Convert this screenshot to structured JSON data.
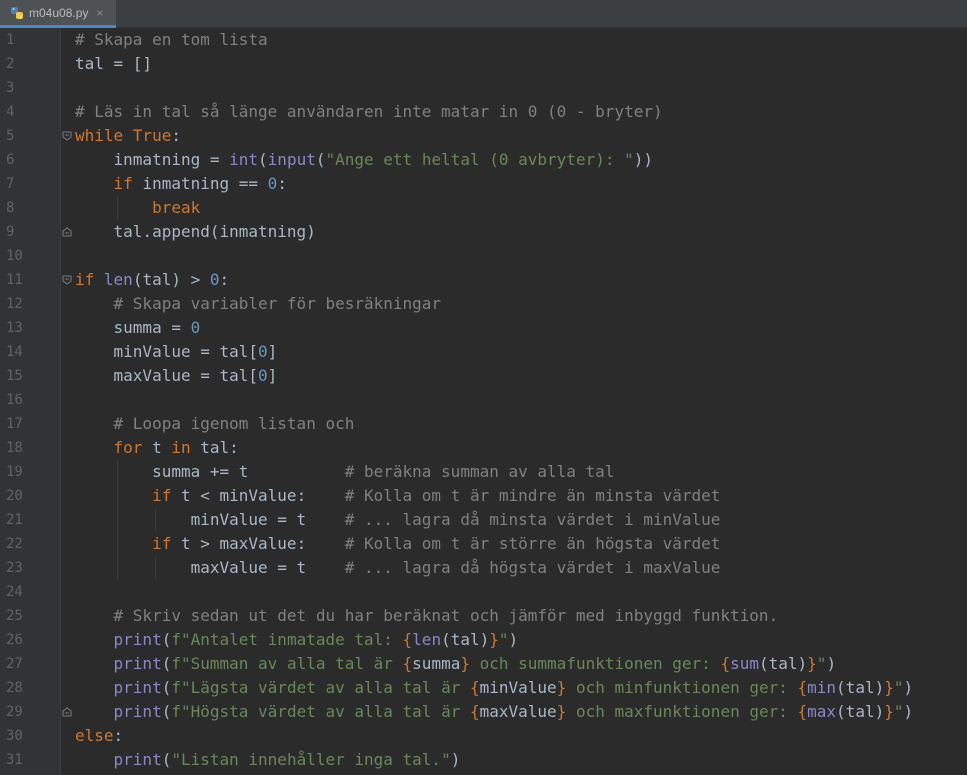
{
  "tab": {
    "filename": "m04u08.py",
    "close_glyph": "×",
    "icon": "python-file-icon"
  },
  "colors": {
    "background": "#2b2b2b",
    "gutter": "#313335",
    "comment": "#808080",
    "keyword": "#cc7832",
    "builtin": "#8888c6",
    "number": "#6897bb",
    "string": "#6a8759",
    "text": "#a9b7c6"
  },
  "lines": [
    {
      "n": "1",
      "tokens": [
        [
          "comment",
          "# Skapa en tom lista"
        ]
      ]
    },
    {
      "n": "2",
      "tokens": [
        [
          "plain",
          "tal = []"
        ]
      ]
    },
    {
      "n": "3",
      "tokens": []
    },
    {
      "n": "4",
      "tokens": [
        [
          "comment",
          "# Läs in tal så länge användaren inte matar in 0 (0 - bryter)"
        ]
      ]
    },
    {
      "n": "5",
      "tokens": [
        [
          "kw",
          "while "
        ],
        [
          "kw",
          "True"
        ],
        [
          "plain",
          ":"
        ]
      ]
    },
    {
      "n": "6",
      "tokens": [
        [
          "plain",
          "    inmatning = "
        ],
        [
          "builtin",
          "int"
        ],
        [
          "plain",
          "("
        ],
        [
          "builtin",
          "input"
        ],
        [
          "plain",
          "("
        ],
        [
          "str",
          "\"Ange ett heltal (0 avbryter): \""
        ],
        [
          "plain",
          "))"
        ]
      ]
    },
    {
      "n": "7",
      "tokens": [
        [
          "plain",
          "    "
        ],
        [
          "kw",
          "if "
        ],
        [
          "plain",
          "inmatning == "
        ],
        [
          "num",
          "0"
        ],
        [
          "plain",
          ":"
        ]
      ]
    },
    {
      "n": "8",
      "tokens": [
        [
          "plain",
          "        "
        ],
        [
          "kw",
          "break"
        ]
      ]
    },
    {
      "n": "9",
      "tokens": [
        [
          "plain",
          "    tal.append(inmatning)"
        ]
      ]
    },
    {
      "n": "10",
      "tokens": []
    },
    {
      "n": "11",
      "tokens": [
        [
          "kw",
          "if "
        ],
        [
          "builtin",
          "len"
        ],
        [
          "plain",
          "(tal) > "
        ],
        [
          "num",
          "0"
        ],
        [
          "plain",
          ":"
        ]
      ]
    },
    {
      "n": "12",
      "tokens": [
        [
          "plain",
          "    "
        ],
        [
          "comment",
          "# Skapa variabler för besräkningar"
        ]
      ]
    },
    {
      "n": "13",
      "tokens": [
        [
          "plain",
          "    summa = "
        ],
        [
          "num",
          "0"
        ]
      ]
    },
    {
      "n": "14",
      "tokens": [
        [
          "plain",
          "    minValue = tal["
        ],
        [
          "num",
          "0"
        ],
        [
          "plain",
          "]"
        ]
      ]
    },
    {
      "n": "15",
      "tokens": [
        [
          "plain",
          "    maxValue = tal["
        ],
        [
          "num",
          "0"
        ],
        [
          "plain",
          "]"
        ]
      ]
    },
    {
      "n": "16",
      "tokens": []
    },
    {
      "n": "17",
      "tokens": [
        [
          "plain",
          "    "
        ],
        [
          "comment",
          "# Loopa igenom listan och"
        ]
      ]
    },
    {
      "n": "18",
      "tokens": [
        [
          "plain",
          "    "
        ],
        [
          "kw",
          "for "
        ],
        [
          "plain",
          "t "
        ],
        [
          "kw",
          "in "
        ],
        [
          "plain",
          "tal:"
        ]
      ]
    },
    {
      "n": "19",
      "tokens": [
        [
          "plain",
          "        summa += t          "
        ],
        [
          "comment",
          "# beräkna summan av alla tal"
        ]
      ]
    },
    {
      "n": "20",
      "tokens": [
        [
          "plain",
          "        "
        ],
        [
          "kw",
          "if "
        ],
        [
          "plain",
          "t < minValue:    "
        ],
        [
          "comment",
          "# Kolla om t är mindre än minsta värdet"
        ]
      ]
    },
    {
      "n": "21",
      "tokens": [
        [
          "plain",
          "            minValue = t    "
        ],
        [
          "comment",
          "# ... lagra då minsta värdet i minValue"
        ]
      ]
    },
    {
      "n": "22",
      "tokens": [
        [
          "plain",
          "        "
        ],
        [
          "kw",
          "if "
        ],
        [
          "plain",
          "t > maxValue:    "
        ],
        [
          "comment",
          "# Kolla om t är större än högsta värdet"
        ]
      ]
    },
    {
      "n": "23",
      "tokens": [
        [
          "plain",
          "            maxValue = t    "
        ],
        [
          "comment",
          "# ... lagra då högsta värdet i maxValue"
        ]
      ]
    },
    {
      "n": "24",
      "tokens": []
    },
    {
      "n": "25",
      "tokens": [
        [
          "plain",
          "    "
        ],
        [
          "comment",
          "# Skriv sedan ut det du har beräknat och jämför med inbyggd funktion."
        ]
      ]
    },
    {
      "n": "26",
      "tokens": [
        [
          "plain",
          "    "
        ],
        [
          "builtin",
          "print"
        ],
        [
          "plain",
          "("
        ],
        [
          "str",
          "f\"Antalet inmatade tal: "
        ],
        [
          "brace",
          "{"
        ],
        [
          "builtin",
          "len"
        ],
        [
          "plain",
          "(tal)"
        ],
        [
          "brace",
          "}"
        ],
        [
          "str",
          "\""
        ],
        [
          "plain",
          ")"
        ]
      ]
    },
    {
      "n": "27",
      "tokens": [
        [
          "plain",
          "    "
        ],
        [
          "builtin",
          "print"
        ],
        [
          "plain",
          "("
        ],
        [
          "str",
          "f\"Summan av alla tal är "
        ],
        [
          "brace",
          "{"
        ],
        [
          "plain",
          "summa"
        ],
        [
          "brace",
          "}"
        ],
        [
          "str",
          " och summafunktionen ger: "
        ],
        [
          "brace",
          "{"
        ],
        [
          "builtin",
          "sum"
        ],
        [
          "plain",
          "(tal)"
        ],
        [
          "brace",
          "}"
        ],
        [
          "str",
          "\""
        ],
        [
          "plain",
          ")"
        ]
      ]
    },
    {
      "n": "28",
      "tokens": [
        [
          "plain",
          "    "
        ],
        [
          "builtin",
          "print"
        ],
        [
          "plain",
          "("
        ],
        [
          "str",
          "f\"Lägsta värdet av alla tal är "
        ],
        [
          "brace",
          "{"
        ],
        [
          "plain",
          "minValue"
        ],
        [
          "brace",
          "}"
        ],
        [
          "str",
          " och minfunktionen ger: "
        ],
        [
          "brace",
          "{"
        ],
        [
          "builtin",
          "min"
        ],
        [
          "plain",
          "(tal)"
        ],
        [
          "brace",
          "}"
        ],
        [
          "str",
          "\""
        ],
        [
          "plain",
          ")"
        ]
      ]
    },
    {
      "n": "29",
      "tokens": [
        [
          "plain",
          "    "
        ],
        [
          "builtin",
          "print"
        ],
        [
          "plain",
          "("
        ],
        [
          "str",
          "f\"Högsta värdet av alla tal är "
        ],
        [
          "brace",
          "{"
        ],
        [
          "plain",
          "maxValue"
        ],
        [
          "brace",
          "}"
        ],
        [
          "str",
          " och maxfunktionen ger: "
        ],
        [
          "brace",
          "{"
        ],
        [
          "builtin",
          "max"
        ],
        [
          "plain",
          "(tal)"
        ],
        [
          "brace",
          "}"
        ],
        [
          "str",
          "\""
        ],
        [
          "plain",
          ")"
        ]
      ]
    },
    {
      "n": "30",
      "tokens": [
        [
          "kw",
          "else"
        ],
        [
          "plain",
          ":"
        ]
      ]
    },
    {
      "n": "31",
      "tokens": [
        [
          "plain",
          "    "
        ],
        [
          "builtin",
          "print"
        ],
        [
          "plain",
          "("
        ],
        [
          "str",
          "\"Listan innehåller inga tal.\""
        ],
        [
          "plain",
          ")"
        ]
      ]
    }
  ],
  "folds": [
    {
      "line": "5",
      "kind": "open"
    },
    {
      "line": "9",
      "kind": "close"
    },
    {
      "line": "11",
      "kind": "open"
    },
    {
      "line": "29",
      "kind": "close"
    }
  ]
}
